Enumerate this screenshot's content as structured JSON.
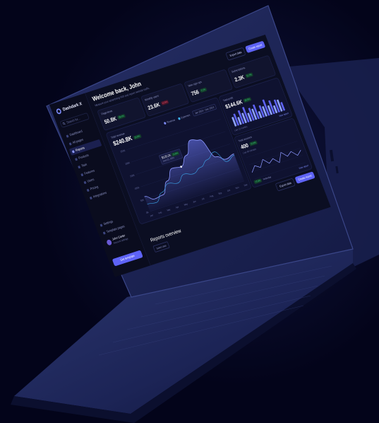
{
  "colors": {
    "background": "#03041a",
    "screen": "#0b0e22",
    "accent": "#5e63f6",
    "positive": "#34d07f",
    "negative": "#ff5a7a"
  },
  "sidebar": {
    "logo": "Dashdark X",
    "search_placeholder": "Search for...",
    "items": [
      {
        "label": "Dashboard",
        "icon": "home-icon"
      },
      {
        "label": "All pages",
        "icon": "pages-icon"
      },
      {
        "label": "Reports",
        "icon": "chart-icon",
        "active": true
      },
      {
        "label": "Products",
        "icon": "box-icon"
      },
      {
        "label": "Task",
        "icon": "task-icon"
      },
      {
        "label": "Features",
        "icon": "star-icon"
      },
      {
        "label": "Users",
        "icon": "user-icon"
      },
      {
        "label": "Pricing",
        "icon": "price-icon"
      },
      {
        "label": "Integrations",
        "icon": "plug-icon"
      }
    ],
    "bottom_items": [
      {
        "label": "Settings",
        "icon": "gear-icon"
      },
      {
        "label": "Template pages",
        "icon": "template-icon"
      }
    ],
    "user": {
      "name": "John Carter",
      "role": "Account settings"
    },
    "cta": "Get template"
  },
  "header": {
    "title": "Welcome back, John",
    "subtitle": "Measure your advertising ROI and report website traffic.",
    "export_label": "Export data",
    "create_label": "Create report"
  },
  "kpis": [
    {
      "label": "Pageviews",
      "value": "50.8K",
      "change": "28.4%",
      "trend": "up"
    },
    {
      "label": "Monthly users",
      "value": "23.6K",
      "change": "12.6%",
      "trend": "down"
    },
    {
      "label": "New sign ups",
      "value": "756",
      "change": "3.1%",
      "trend": "up"
    },
    {
      "label": "Subscriptions",
      "value": "2.3K",
      "change": "11.3%",
      "trend": "up"
    }
  ],
  "revenue_card": {
    "label": "Total revenue",
    "value": "$240.8K",
    "change": "24.6%",
    "legend": [
      "Revenue",
      "Expenses"
    ],
    "period": "Jan 2024 - Dec 2024",
    "tooltip_value": "$125.2K",
    "tooltip_change": "14.8%",
    "tooltip_date": "June 21, 2023",
    "y_ticks": [
      "250K",
      "200K",
      "150K",
      "100K",
      "50K",
      "0K"
    ],
    "x_ticks": [
      "Jan",
      "Feb",
      "Mar",
      "Apr",
      "May",
      "Jun",
      "Jul",
      "Aug",
      "Sep",
      "Oct",
      "Nov",
      "Dec"
    ]
  },
  "profit_card": {
    "label": "Total profit",
    "value": "$144.6K",
    "change": "28.5%",
    "sub": "Last 12 months",
    "link": "View report"
  },
  "sessions_card": {
    "label": "Total sessions",
    "value": "400",
    "change": "16.8%",
    "sub": "Live 60 minutes",
    "foot_badge": "+3.4%",
    "foot": "Yesterday",
    "link": "View report"
  },
  "bottom": {
    "export_label": "Export data",
    "create_label": "Create report",
    "reports_title": "Reports overview",
    "reports_chip": "Select date"
  },
  "chart_data": [
    {
      "type": "area",
      "title": "Total revenue",
      "categories": [
        "Jan",
        "Feb",
        "Mar",
        "Apr",
        "May",
        "Jun",
        "Jul",
        "Aug",
        "Sep",
        "Oct",
        "Nov",
        "Dec"
      ],
      "series": [
        {
          "name": "Revenue",
          "values": [
            60,
            40,
            45,
            90,
            130,
            125,
            160,
            210,
            200,
            120,
            100,
            110
          ]
        },
        {
          "name": "Expenses",
          "values": [
            30,
            25,
            55,
            80,
            70,
            95,
            85,
            100,
            120,
            140,
            90,
            105
          ]
        }
      ],
      "ylim": [
        0,
        250
      ]
    },
    {
      "type": "bar",
      "title": "Total profit",
      "values": [
        55,
        70,
        45,
        80,
        60,
        90,
        50,
        75,
        65,
        85,
        40,
        70,
        60,
        95,
        55,
        80,
        45,
        75,
        70,
        50
      ]
    },
    {
      "type": "line",
      "title": "Total sessions",
      "values": [
        30,
        55,
        40,
        70,
        45,
        60,
        35,
        75,
        50,
        65,
        40,
        58
      ]
    }
  ]
}
